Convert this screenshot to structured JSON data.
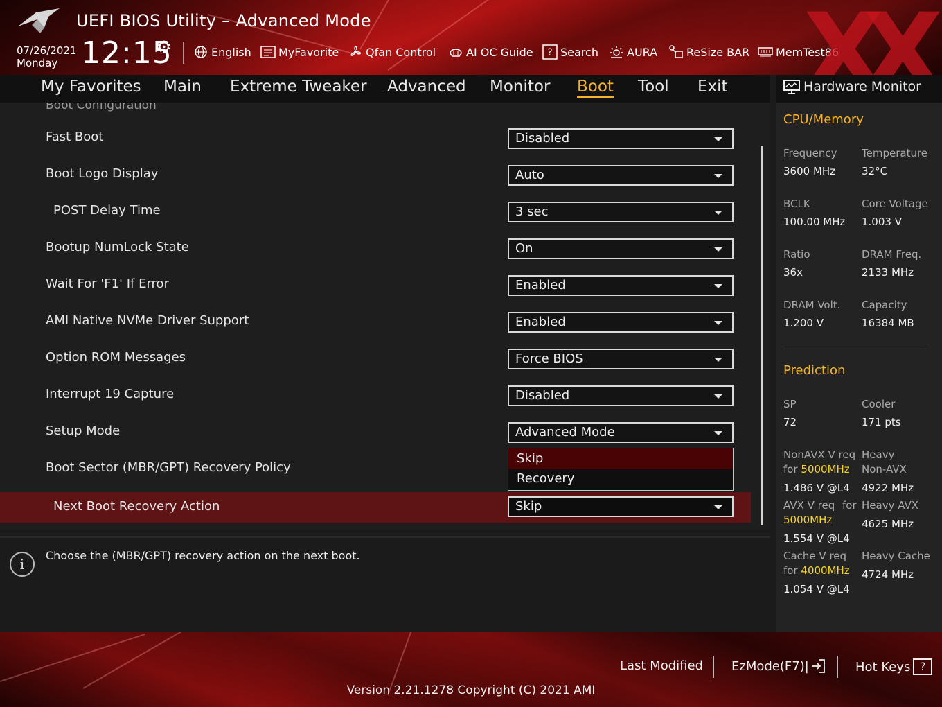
{
  "header": {
    "title": "UEFI BIOS Utility – Advanced Mode",
    "date": "07/26/2021",
    "day": "Monday",
    "time": "12:15",
    "tools": [
      {
        "label": "English",
        "icon": "globe-icon"
      },
      {
        "label": "MyFavorite",
        "icon": "favorite-icon"
      },
      {
        "label": "Qfan Control",
        "icon": "fan-icon"
      },
      {
        "label": "AI OC Guide",
        "icon": "ai-oc-icon"
      },
      {
        "label": "Search",
        "icon": "search-icon"
      },
      {
        "label": "AURA",
        "icon": "aura-icon"
      },
      {
        "label": "ReSize BAR",
        "icon": "resize-bar-icon"
      },
      {
        "label": "MemTest86",
        "icon": "memtest-icon"
      }
    ]
  },
  "nav": {
    "tabs": [
      "My Favorites",
      "Main",
      "Extreme Tweaker",
      "Advanced",
      "Monitor",
      "Boot",
      "Tool",
      "Exit"
    ],
    "active": "Boot"
  },
  "main": {
    "section_title": "Boot Configuration",
    "rows": [
      {
        "label": "Fast Boot",
        "value": "Disabled"
      },
      {
        "label": "Boot Logo Display",
        "value": "Auto"
      },
      {
        "label": "POST Delay Time",
        "value": "3 sec"
      },
      {
        "label": "Bootup NumLock State",
        "value": "On"
      },
      {
        "label": "Wait For 'F1' If Error",
        "value": "Enabled"
      },
      {
        "label": "AMI Native NVMe Driver Support",
        "value": "Enabled"
      },
      {
        "label": "Option ROM Messages",
        "value": "Force BIOS"
      },
      {
        "label": "Interrupt 19 Capture",
        "value": "Disabled"
      },
      {
        "label": "Setup Mode",
        "value": "Advanced Mode"
      },
      {
        "label": "Boot Sector (MBR/GPT) Recovery Policy",
        "value": ""
      },
      {
        "label": "Next Boot Recovery Action",
        "value": "Skip"
      }
    ],
    "dropdown_options": [
      "Skip",
      "Recovery"
    ],
    "help_text": "Choose the (MBR/GPT) recovery action on the next boot."
  },
  "hw_monitor": {
    "title": "Hardware Monitor",
    "cpu_memory": {
      "heading": "CPU/Memory",
      "frequency_label": "Frequency",
      "frequency": "3600 MHz",
      "temperature_label": "Temperature",
      "temperature": "32°C",
      "bclk_label": "BCLK",
      "bclk": "100.00 MHz",
      "core_voltage_label": "Core Voltage",
      "core_voltage": "1.003 V",
      "ratio_label": "Ratio",
      "ratio": "36x",
      "dram_freq_label": "DRAM Freq.",
      "dram_freq": "2133 MHz",
      "dram_volt_label": "DRAM Volt.",
      "dram_volt": "1.200 V",
      "capacity_label": "Capacity",
      "capacity": "16384 MB"
    },
    "prediction": {
      "heading": "Prediction",
      "sp_label": "SP",
      "sp": "72",
      "cooler_label": "Cooler",
      "cooler": "171 pts",
      "nonavx_label": "NonAVX V req",
      "for": "for",
      "nonavx_freq": "5000MHz",
      "nonavx_v": "1.486 V @L4",
      "heavy_nonavx_label1": "Heavy",
      "heavy_nonavx_label2": "Non-AVX",
      "heavy_nonavx": "4922 MHz",
      "avx_label": "AVX V req",
      "avx_for": "for",
      "avx_freq": "5000MHz",
      "avx_v": "1.554 V @L4",
      "heavy_avx_label": "Heavy AVX",
      "heavy_avx": "4625 MHz",
      "cache_label": "Cache V req",
      "cache_freq": "4000MHz",
      "cache_v": "1.054 V @L4",
      "heavy_cache_label": "Heavy Cache",
      "heavy_cache": "4724 MHz"
    }
  },
  "footer": {
    "last_modified": "Last Modified",
    "ezmode": "EzMode(F7)|",
    "hot_keys": "Hot Keys",
    "hot_keys_symbol": "?",
    "version": "Version 2.21.1278 Copyright (C) 2021 AMI"
  },
  "colors": {
    "accent": "#f5b32a",
    "selected_row": "#5e1315",
    "header_red": "#b71414"
  }
}
